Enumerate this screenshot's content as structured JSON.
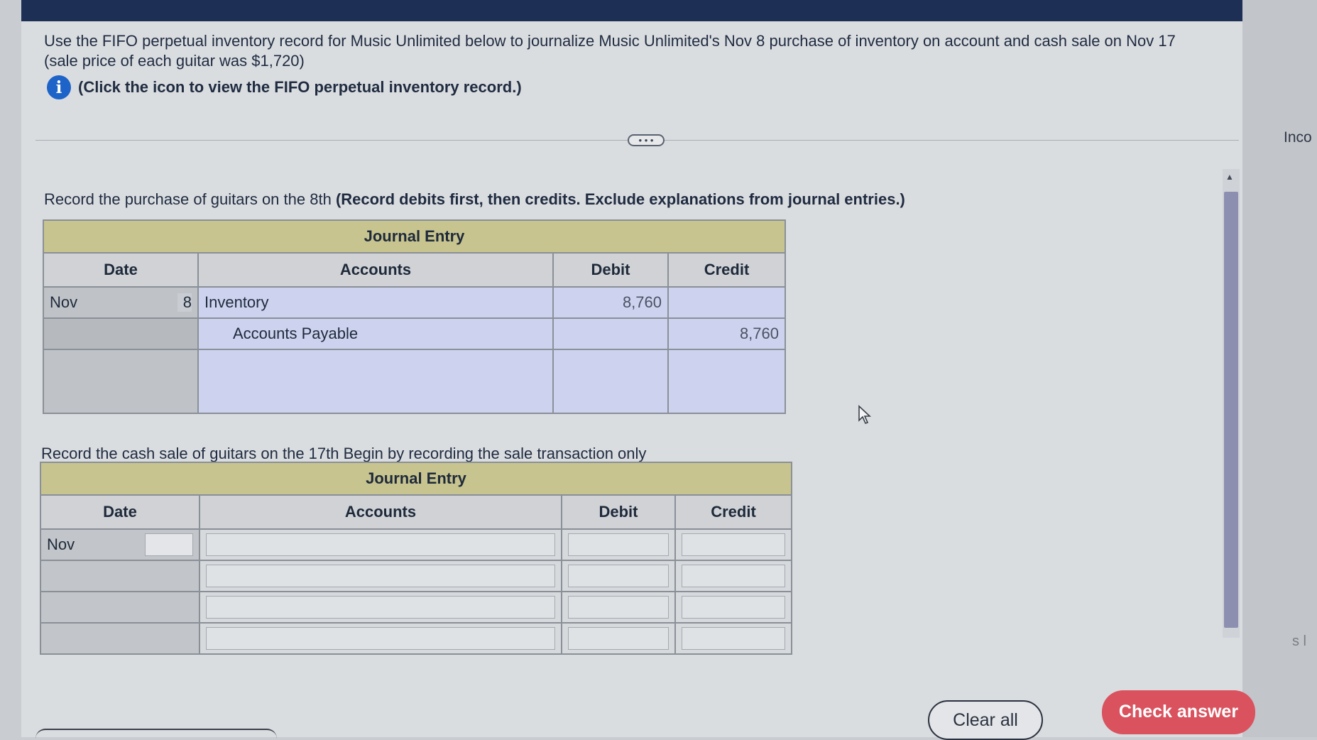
{
  "instruction": {
    "line1": "Use the FIFO perpetual inventory record for Music Unlimited below to journalize Music Unlimited's Nov  8 purchase of inventory on account and cash sale on Nov  17",
    "line2": "(sale price of each guitar was $1,720)",
    "info_link": "(Click the icon to view the FIFO perpetual inventory record.)"
  },
  "expander_label": "• • •",
  "side_label": "Inco",
  "side_mark": "s l",
  "purchase_section": {
    "prompt_plain": "Record the purchase of guitars on the 8th",
    "prompt_bold": "(Record debits first, then credits. Exclude explanations from journal entries.)",
    "table_title": "Journal Entry",
    "headers": {
      "date": "Date",
      "accounts": "Accounts",
      "debit": "Debit",
      "credit": "Credit"
    },
    "rows": [
      {
        "month": "Nov",
        "day": "8",
        "account": "Inventory",
        "debit": "8,760",
        "credit": ""
      },
      {
        "month": "",
        "day": "",
        "account": "Accounts Payable",
        "debit": "",
        "credit": "8,760"
      },
      {
        "month": "",
        "day": "",
        "account": "",
        "debit": "",
        "credit": ""
      }
    ]
  },
  "sale_section": {
    "prompt": "Record the cash sale of guitars on the 17th  Begin by recording the sale transaction only",
    "table_title": "Journal Entry",
    "headers": {
      "date": "Date",
      "accounts": "Accounts",
      "debit": "Debit",
      "credit": "Credit"
    },
    "month": "Nov"
  },
  "buttons": {
    "clear_all": "Clear all",
    "check_answer": "Check answer"
  },
  "colors": {
    "check_answer": "#d9525e",
    "info_icon": "#1d63c8",
    "title_bar": "#1d2f55",
    "journal_header": "#c8c48f"
  }
}
